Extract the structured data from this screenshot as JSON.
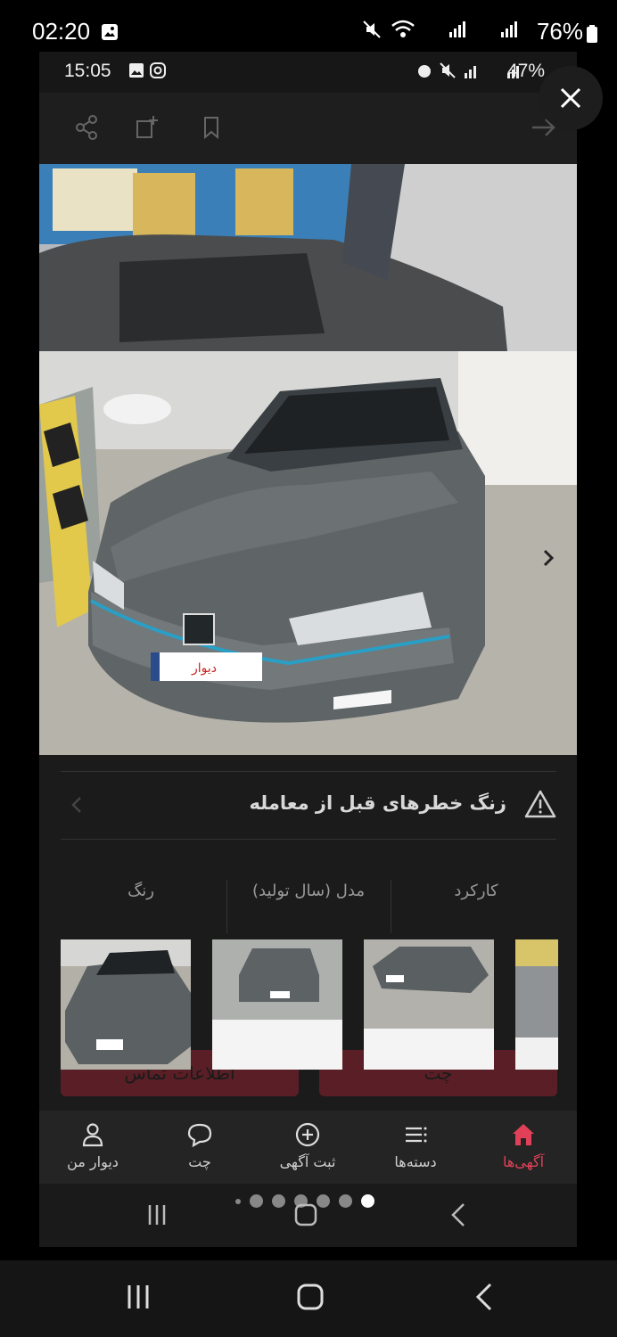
{
  "outer_status": {
    "time": "02:20",
    "battery": "76%"
  },
  "inner_status": {
    "time": "15:05",
    "battery": "47%"
  },
  "toolbar": {
    "icons": [
      "share-icon",
      "report-icon",
      "bookmark-icon",
      "back-arrow-icon"
    ]
  },
  "hero": {
    "plate_text": "دیوار"
  },
  "warning": {
    "text": "زنگ خطرهای قبل از معامله"
  },
  "specs": {
    "mileage_label": "کارکرد",
    "model_label": "مدل (سال تولید)",
    "color_label": "رنگ"
  },
  "actions": {
    "contact_label": "اطلاعات تماس",
    "chat_label": "چت"
  },
  "bottom_nav": {
    "items": [
      {
        "label": "دیوار من",
        "icon": "user-icon"
      },
      {
        "label": "چت",
        "icon": "chat-icon"
      },
      {
        "label": "ثبت آگهی",
        "icon": "add-icon"
      },
      {
        "label": "دسته‌ها",
        "icon": "categories-icon"
      },
      {
        "label": "آگهی‌ها",
        "icon": "home-icon"
      }
    ],
    "active": "آگهی‌ها"
  },
  "colors": {
    "accent": "#e04158",
    "background": "#1b1b1b",
    "button": "#5a1f26"
  }
}
